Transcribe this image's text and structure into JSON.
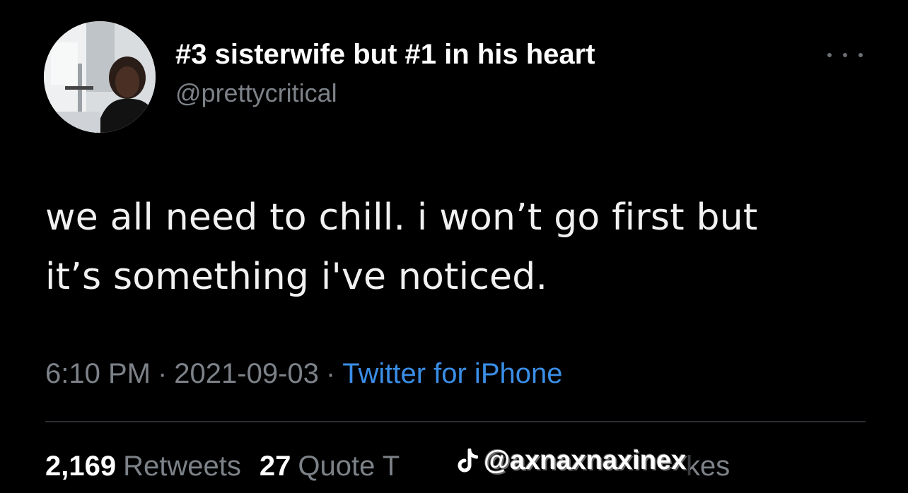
{
  "tweet": {
    "display_name": "#3 sisterwife but #1 in his heart",
    "handle": "@prettycritical",
    "text_lines": [
      "we all need to chill. i won’t go first but",
      "it’s something i've noticed."
    ],
    "time": "6:10 PM",
    "date": "2021-09-03",
    "separator": "·",
    "source": "Twitter for iPhone",
    "more_icon": "more-horizontal-icon"
  },
  "stats": {
    "retweets_count": "2,169",
    "retweets_label": "Retweets",
    "quotes_count": "27",
    "quotes_label": "Quote T",
    "likes_label_tail": "kes"
  },
  "watermark": {
    "text": "@axnaxnaxinex",
    "icon": "tiktok-logo-icon"
  },
  "colors": {
    "background": "#000000",
    "text_primary": "#ffffff",
    "text_secondary": "#7c8288",
    "link": "#3a8ee6",
    "divider": "#2a2d30"
  }
}
